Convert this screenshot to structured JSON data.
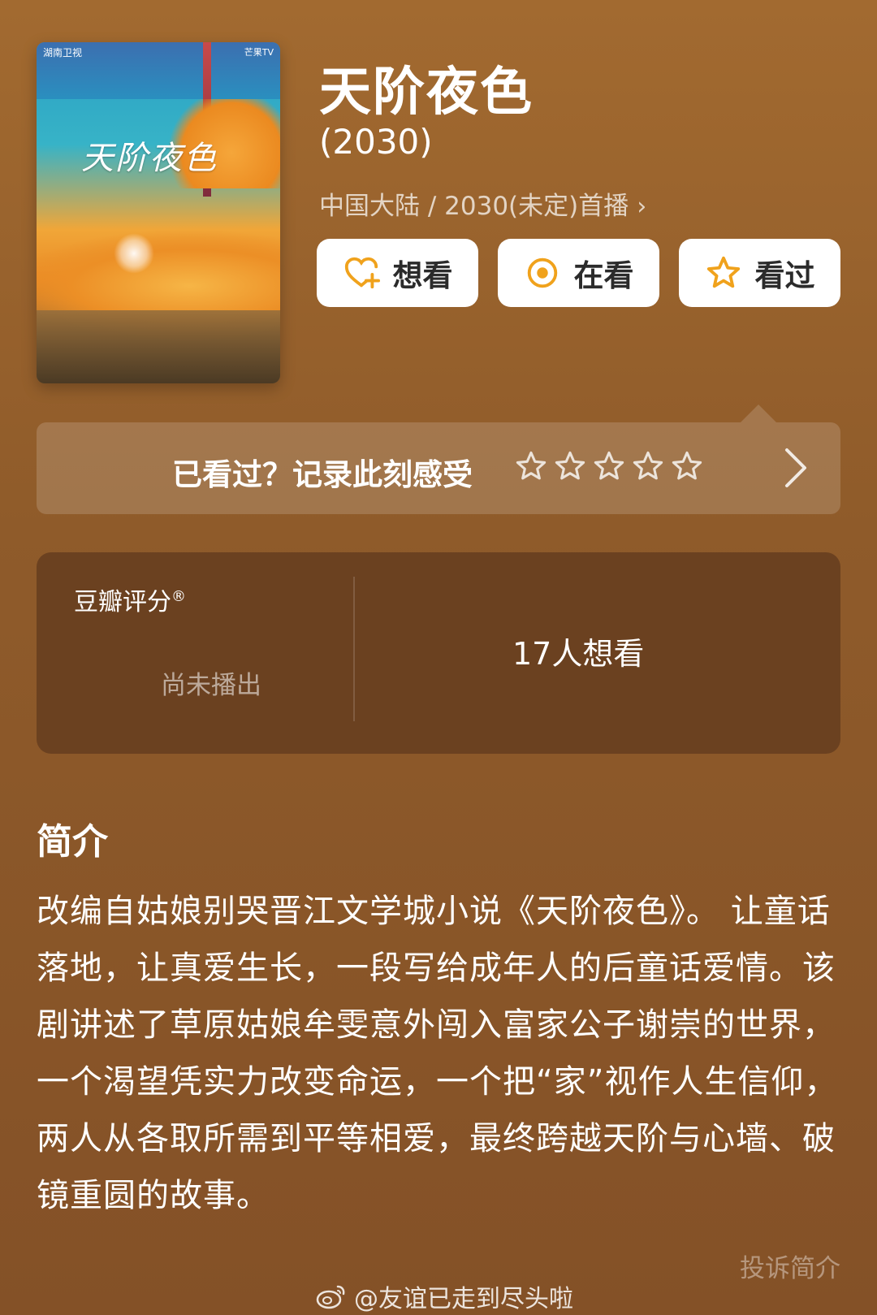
{
  "poster": {
    "calligraphy_title": "天阶夜色",
    "brand_left": "湖南卫视",
    "brand_right": "芒果TV"
  },
  "header": {
    "title": "天阶夜色",
    "year": "(2030)",
    "meta": "中国大陆 / 2030(未定)首播"
  },
  "actions": [
    {
      "label": "想看",
      "icon": "heart-plus-icon"
    },
    {
      "label": "在看",
      "icon": "target-circle-icon"
    },
    {
      "label": "看过",
      "icon": "star-outline-icon"
    }
  ],
  "rating_prompt": {
    "text": "已看过？记录此刻感受",
    "stars": 5,
    "icon": "chevron-right-icon"
  },
  "score_panel": {
    "label": "豆瓣评分",
    "status": "尚未播出",
    "want_count": "17人想看"
  },
  "synopsis": {
    "heading": "简介",
    "body": "改编自姑娘别哭晋江文学城小说《天阶夜色》。 让童话落地，让真爱生长，一段写给成年人的后童话爱情。该剧讲述了草原姑娘牟雯意外闯入富家公子谢崇的世界，一个渴望凭实力改变命运，一个把“家”视作人生信仰，两人从各取所需到平等相爱，最终跨越天阶与心墙、破镜重圆的故事。",
    "complain_link": "投诉简介"
  },
  "watermark": {
    "text": "@友谊已走到尽头啦",
    "icon": "weibo-icon"
  },
  "colors": {
    "background": "#9a6430",
    "panel": "#6b4120",
    "accent": "#f0a21c"
  }
}
